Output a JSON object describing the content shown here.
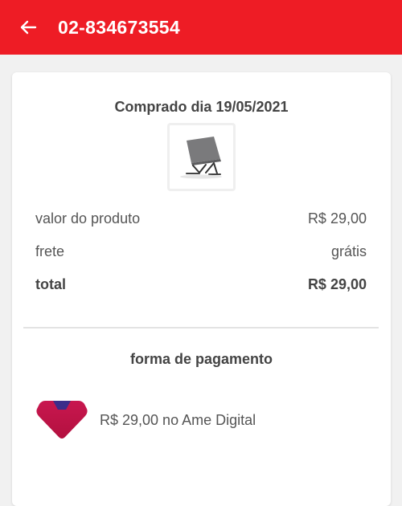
{
  "header": {
    "title": "02-834673554",
    "bg_color": "#ee1c25",
    "back_icon": "arrow-left-icon"
  },
  "order": {
    "purchase_date": "Comprado dia 19/05/2021",
    "summary": {
      "product_label": "valor do produto",
      "product_value": "R$ 29,00",
      "shipping_label": "frete",
      "shipping_value": "grátis",
      "total_label": "total",
      "total_value": "R$ 29,00"
    }
  },
  "payment": {
    "heading": "forma de pagamento",
    "method_text": "R$ 29,00 no Ame Digital",
    "logo_icon": "ame-digital-logo"
  }
}
